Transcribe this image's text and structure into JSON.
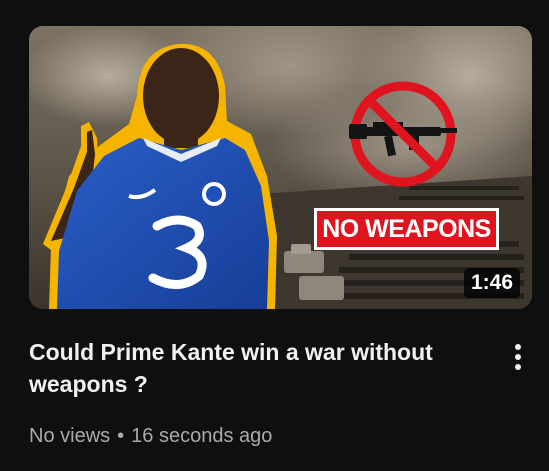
{
  "video": {
    "title": "Could Prime Kante win a war without weapons ?",
    "views": "No views",
    "separator": "•",
    "uploaded": "16 seconds ago",
    "duration": "1:46"
  },
  "thumbnail": {
    "banner_text": "NO WEAPONS",
    "colors": {
      "ban_sign": "#e0141f",
      "jersey": "#1f4fb8",
      "outline": "#f5b400"
    }
  },
  "menu": {
    "icon": "more-vert-icon"
  }
}
